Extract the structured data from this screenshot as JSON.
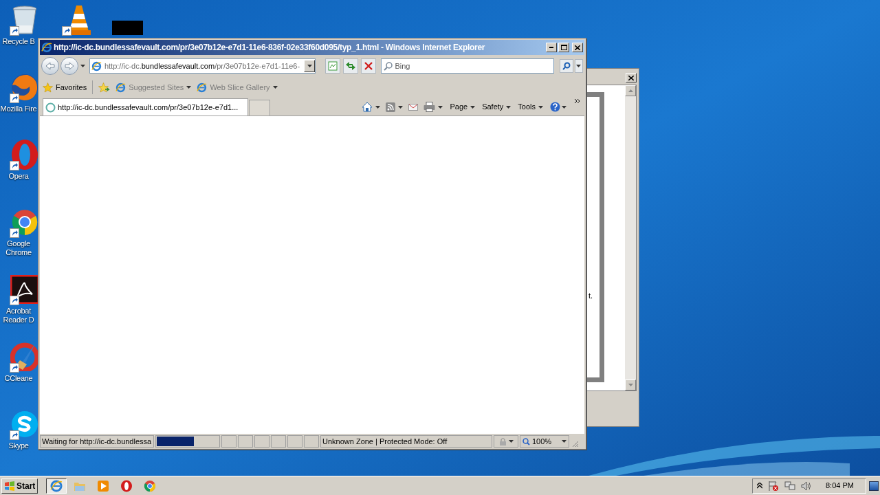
{
  "desktop": {
    "icons": [
      {
        "kind": "recycle",
        "label": "Recycle B"
      },
      {
        "kind": "firefox",
        "label": "Mozilla Fire"
      },
      {
        "kind": "opera",
        "label": "Opera"
      },
      {
        "kind": "chrome",
        "label": "Google Chrome"
      },
      {
        "kind": "acrobat",
        "label": "Acrobat Reader D"
      },
      {
        "kind": "ccleaner",
        "label": "CCleane"
      },
      {
        "kind": "skype",
        "label": "Skype"
      }
    ]
  },
  "background_window": {
    "text": "t."
  },
  "ie_window": {
    "title": "http://ic-dc.bundlessafevault.com/pr/3e07b12e-e7d1-11e6-836f-02e33f60d095/typ_1.html - Windows Internet Explorer",
    "address": {
      "prefix": "http://ic-dc.",
      "domain": "bundlessafevault.com",
      "suffix": "/pr/3e07b12e-e7d1-11e6-"
    },
    "search": {
      "placeholder": "Bing"
    },
    "favorites_bar": [
      {
        "kind": "favorites",
        "label": "Favorites"
      },
      {
        "kind": "link",
        "label": "Suggested Sites"
      },
      {
        "kind": "link",
        "label": "Web Slice Gallery"
      }
    ],
    "tabs": [
      {
        "label": "http://ic-dc.bundlessafevault.com/pr/3e07b12e-e7d1...",
        "selected": true
      }
    ],
    "command_bar": [
      "Page",
      "Safety",
      "Tools"
    ],
    "status_bar": {
      "text": "Waiting for http://ic-dc.bundlessa",
      "progress": {
        "level": 0.6
      },
      "zone": "Unknown Zone | Protected Mode: Off",
      "zoom": "100%"
    }
  },
  "taskbar": {
    "start": "Start",
    "apps": [
      {
        "kind": "ie",
        "selected": true
      },
      {
        "kind": "folder",
        "selected": false
      },
      {
        "kind": "media",
        "selected": false
      },
      {
        "kind": "opera",
        "selected": false
      },
      {
        "kind": "chrome",
        "selected": false
      }
    ],
    "clock": "8:04 PM"
  }
}
